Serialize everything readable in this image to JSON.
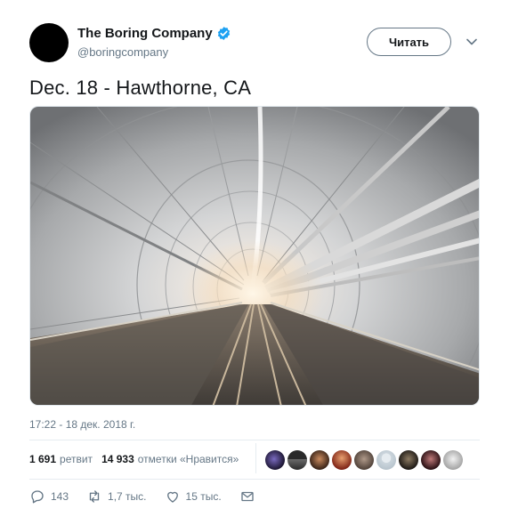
{
  "author": {
    "name": "The Boring Company",
    "handle": "@boringcompany",
    "verified": true
  },
  "follow_button": {
    "label": "Читать"
  },
  "tweet": {
    "text": "Dec. 18 - Hawthorne, CA",
    "timestamp": "17:22 - 18 дек. 2018 г."
  },
  "stats": {
    "retweets_count": "1 691",
    "retweets_label": "ретвит",
    "likes_count": "14 933",
    "likes_label": "отметки «Нравится»"
  },
  "actions": {
    "replies": "143",
    "retweets": "1,7 тыс.",
    "likes": "15 тыс."
  },
  "icons": {
    "verified": "verified-badge-icon",
    "caret": "chevron-down-icon",
    "reply": "reply-icon",
    "retweet": "retweet-icon",
    "like": "heart-icon",
    "message": "envelope-icon"
  },
  "colors": {
    "accent": "#1da1f2",
    "text": "#14171a",
    "secondary": "#657786"
  }
}
